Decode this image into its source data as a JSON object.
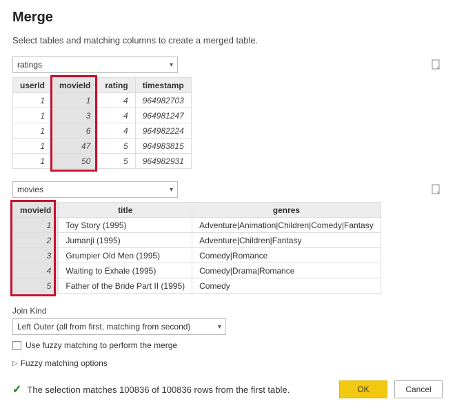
{
  "title": "Merge",
  "subtitle": "Select tables and matching columns to create a merged table.",
  "table1": {
    "selected": "ratings",
    "columns": [
      "userId",
      "movieId",
      "rating",
      "timestamp"
    ],
    "rows": [
      [
        "1",
        "1",
        "4",
        "964982703"
      ],
      [
        "1",
        "3",
        "4",
        "964981247"
      ],
      [
        "1",
        "6",
        "4",
        "964982224"
      ],
      [
        "1",
        "47",
        "5",
        "964983815"
      ],
      [
        "1",
        "50",
        "5",
        "964982931"
      ]
    ]
  },
  "table2": {
    "selected": "movies",
    "columns": [
      "movieId",
      "title",
      "genres"
    ],
    "rows": [
      [
        "1",
        "Toy Story (1995)",
        "Adventure|Animation|Children|Comedy|Fantasy"
      ],
      [
        "2",
        "Jumanji (1995)",
        "Adventure|Children|Fantasy"
      ],
      [
        "3",
        "Grumpier Old Men (1995)",
        "Comedy|Romance"
      ],
      [
        "4",
        "Waiting to Exhale (1995)",
        "Comedy|Drama|Romance"
      ],
      [
        "5",
        "Father of the Bride Part II (1995)",
        "Comedy"
      ]
    ]
  },
  "join": {
    "label": "Join Kind",
    "selected": "Left Outer (all from first, matching from second)"
  },
  "fuzzy": {
    "checkbox_label": "Use fuzzy matching to perform the merge",
    "options_label": "Fuzzy matching options"
  },
  "status": "The selection matches 100836 of 100836 rows from the first table.",
  "buttons": {
    "ok": "OK",
    "cancel": "Cancel"
  }
}
